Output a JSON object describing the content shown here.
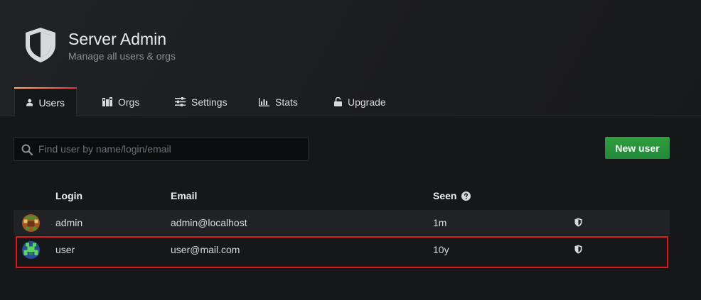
{
  "header": {
    "title": "Server Admin",
    "subtitle": "Manage all users & orgs"
  },
  "tabs": [
    {
      "label": "Users",
      "icon": "user-icon",
      "active": true
    },
    {
      "label": "Orgs",
      "icon": "building-icon",
      "active": false
    },
    {
      "label": "Settings",
      "icon": "sliders-icon",
      "active": false
    },
    {
      "label": "Stats",
      "icon": "bar-chart-icon",
      "active": false
    },
    {
      "label": "Upgrade",
      "icon": "unlock-icon",
      "active": false
    }
  ],
  "search": {
    "placeholder": "Find user by name/login/email",
    "value": ""
  },
  "new_user_label": "New user",
  "table": {
    "headers": {
      "login": "Login",
      "email": "Email",
      "seen": "Seen"
    },
    "rows": [
      {
        "login": "admin",
        "email": "admin@localhost",
        "seen": "1m"
      },
      {
        "login": "user",
        "email": "user@mail.com",
        "seen": "10y"
      }
    ]
  },
  "colors": {
    "accent_green": "#2f9e3c",
    "highlight_red": "#e3151a"
  }
}
